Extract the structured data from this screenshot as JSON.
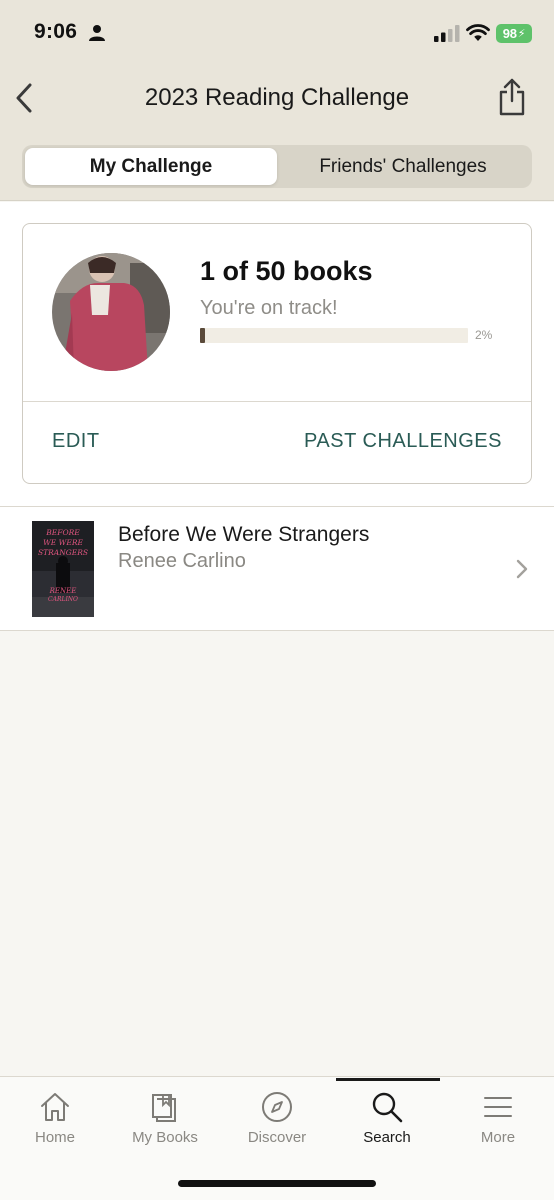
{
  "status_bar": {
    "time": "9:06",
    "battery": "98"
  },
  "nav": {
    "title": "2023 Reading Challenge"
  },
  "segmented": {
    "tabs": [
      {
        "label": "My Challenge",
        "active": true
      },
      {
        "label": "Friends' Challenges",
        "active": false
      }
    ]
  },
  "challenge": {
    "books_count": "1 of 50 books",
    "status": "You're on track!",
    "progress_percent": 2,
    "progress_label": "2%",
    "edit_label": "EDIT",
    "past_label": "PAST CHALLENGES"
  },
  "books": [
    {
      "title": "Before We Were Strangers",
      "author": "Renee Carlino",
      "cover_text": "BEFORE WE WERE STRANGERS"
    }
  ],
  "tabbar": {
    "items": [
      {
        "label": "Home",
        "icon": "home-icon"
      },
      {
        "label": "My Books",
        "icon": "my-books-icon"
      },
      {
        "label": "Discover",
        "icon": "compass-icon"
      },
      {
        "label": "Search",
        "icon": "search-icon",
        "active": true
      },
      {
        "label": "More",
        "icon": "menu-icon"
      }
    ]
  },
  "colors": {
    "header_bg": "#e9e5da",
    "accent_teal": "#2a5b55",
    "progress_fill": "#5a4a3a",
    "battery": "#5ec26a"
  }
}
